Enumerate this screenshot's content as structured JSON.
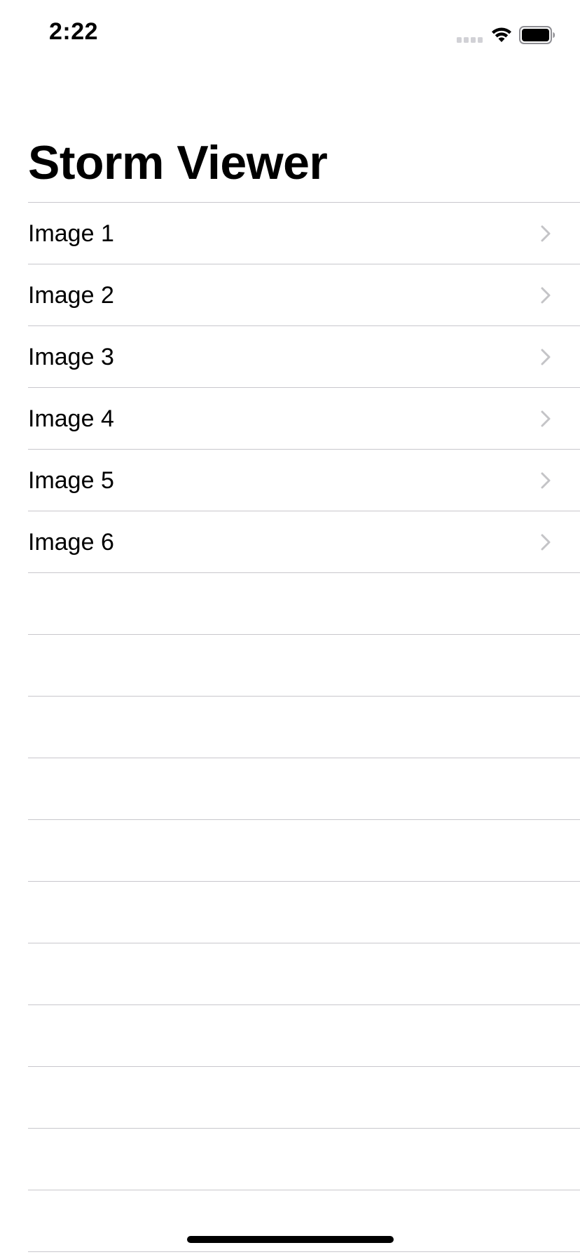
{
  "status_bar": {
    "time": "2:22",
    "signal_icon": "cellular-signal-icon",
    "wifi_icon": "wifi-icon",
    "battery_icon": "battery-full-icon"
  },
  "navigation": {
    "title": "Storm Viewer"
  },
  "table": {
    "rows": [
      {
        "label": "Image 1",
        "accessory": "chevron-right-icon"
      },
      {
        "label": "Image 2",
        "accessory": "chevron-right-icon"
      },
      {
        "label": "Image 3",
        "accessory": "chevron-right-icon"
      },
      {
        "label": "Image 4",
        "accessory": "chevron-right-icon"
      },
      {
        "label": "Image 5",
        "accessory": "chevron-right-icon"
      },
      {
        "label": "Image 6",
        "accessory": "chevron-right-icon"
      }
    ]
  },
  "colors": {
    "separator": "#c8c7cc",
    "chevron": "#c4c4c7",
    "text": "#000000",
    "background": "#ffffff"
  }
}
